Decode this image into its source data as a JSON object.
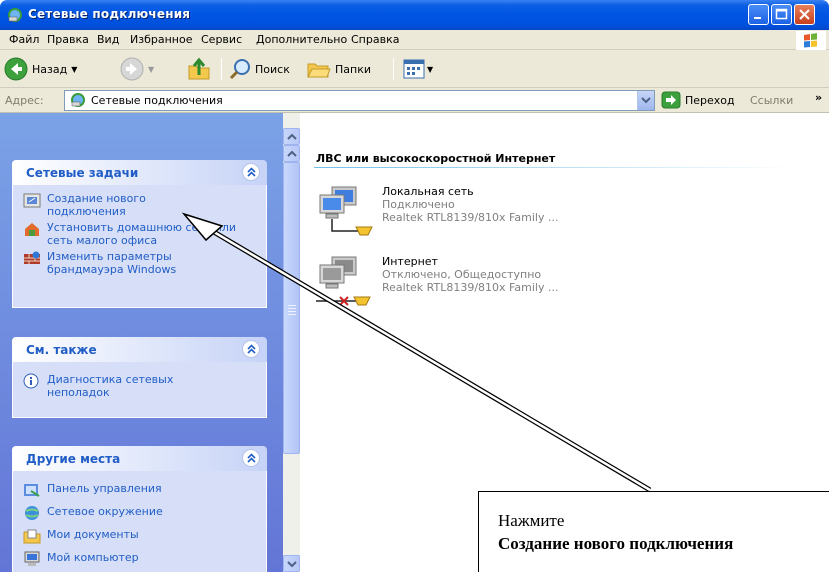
{
  "window": {
    "title": "Сетевые подключения"
  },
  "menu": [
    "Файл",
    "Правка",
    "Вид",
    "Избранное",
    "Сервис",
    "Дополнительно",
    "Справка"
  ],
  "toolbar": {
    "back": "Назад",
    "search": "Поиск",
    "folders": "Папки"
  },
  "address": {
    "label": "Адрес:",
    "value": "Сетевые подключения",
    "go": "Переход",
    "links": "Ссылки"
  },
  "tasks_panel": {
    "title": "Сетевые задачи",
    "items": [
      "Создание нового подключения",
      "Установить домашнюю сеть или сеть малого офиса",
      "Изменить параметры брандмауэра Windows"
    ]
  },
  "see_also": {
    "title": "См. также",
    "items": [
      "Диагностика сетевых неполадок"
    ]
  },
  "other_places": {
    "title": "Другие места",
    "items": [
      "Панель управления",
      "Сетевое окружение",
      "Мои документы",
      "Мой компьютер"
    ]
  },
  "main": {
    "section": "ЛВС или высокоскоростной Интернет",
    "connections": [
      {
        "name": "Локальная сеть",
        "status": "Подключено",
        "device": "Realtek RTL8139/810x Family ..."
      },
      {
        "name": "Интернет",
        "status": "Отключено, Общедоступно",
        "device": "Realtek RTL8139/810x Family ..."
      }
    ]
  },
  "callout": {
    "line1": "Нажмите",
    "line2": "Создание нового подключения"
  }
}
